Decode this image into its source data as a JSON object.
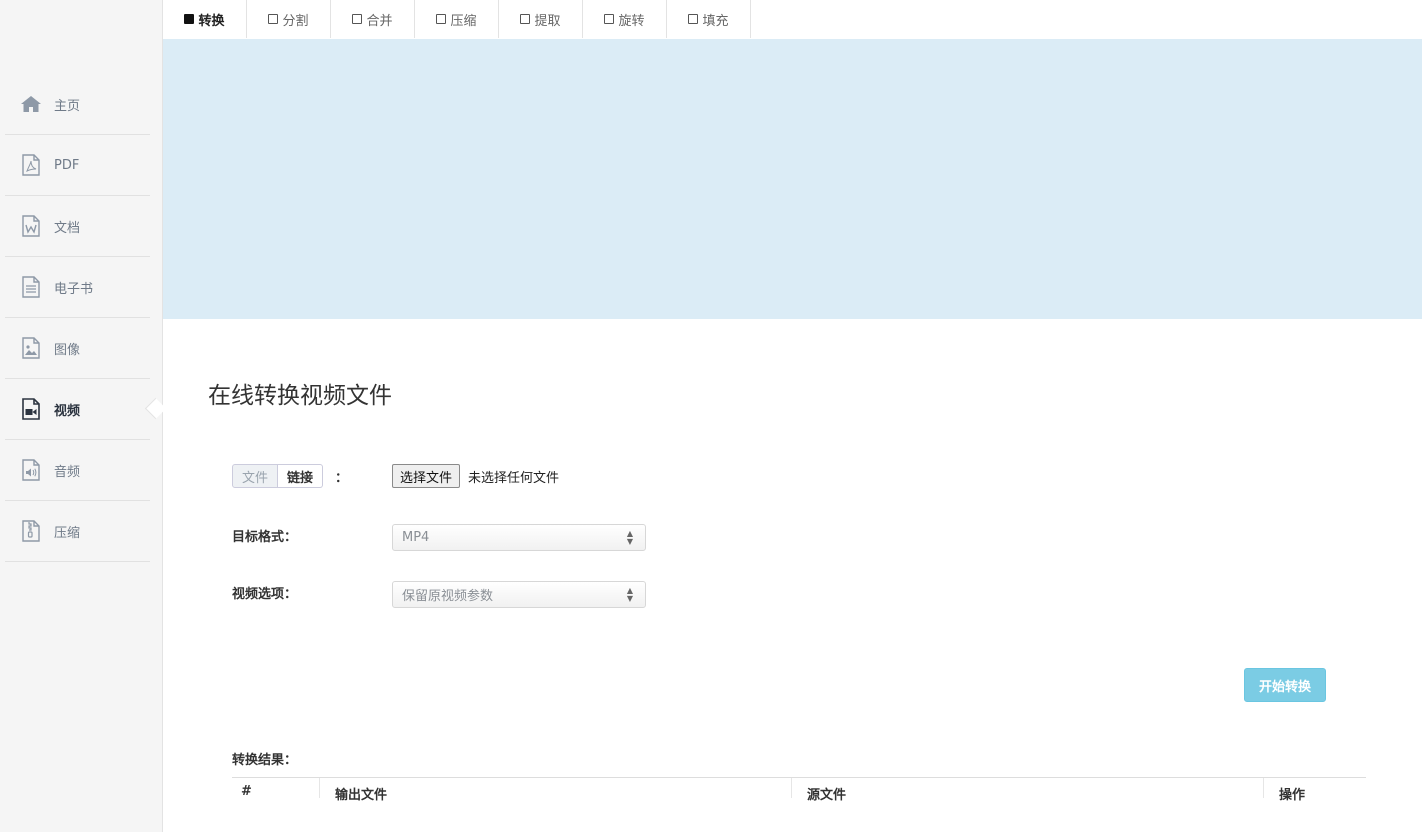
{
  "sidebar": {
    "items": [
      {
        "label": "主页",
        "icon": "home-icon"
      },
      {
        "label": "PDF",
        "icon": "pdf-file-icon"
      },
      {
        "label": "文档",
        "icon": "word-file-icon"
      },
      {
        "label": "电子书",
        "icon": "ebook-file-icon"
      },
      {
        "label": "图像",
        "icon": "image-file-icon"
      },
      {
        "label": "视频",
        "icon": "video-file-icon",
        "active": true
      },
      {
        "label": "音频",
        "icon": "audio-file-icon"
      },
      {
        "label": "压缩",
        "icon": "zip-file-icon"
      }
    ]
  },
  "tabs": [
    {
      "label": "转换",
      "active": true
    },
    {
      "label": "分割"
    },
    {
      "label": "合并"
    },
    {
      "label": "压缩"
    },
    {
      "label": "提取"
    },
    {
      "label": "旋转"
    },
    {
      "label": "填充"
    }
  ],
  "main": {
    "title": "在线转换视频文件",
    "source_toggle": {
      "file_label": "文件",
      "link_label": "链接",
      "colon": "："
    },
    "file_input": {
      "button_label": "选择文件",
      "status": "未选择任何文件"
    },
    "target_format": {
      "label": "目标格式：",
      "value": "MP4"
    },
    "video_options": {
      "label": "视频选项：",
      "value": "保留原视频参数"
    },
    "start_button": "开始转换",
    "results": {
      "label": "转换结果：",
      "columns": [
        "#",
        "输出文件",
        "源文件",
        "操作"
      ]
    }
  },
  "colors": {
    "banner": "#dbecf6",
    "accent_button": "#5bc0de",
    "sidebar_bg": "#f5f5f5"
  }
}
